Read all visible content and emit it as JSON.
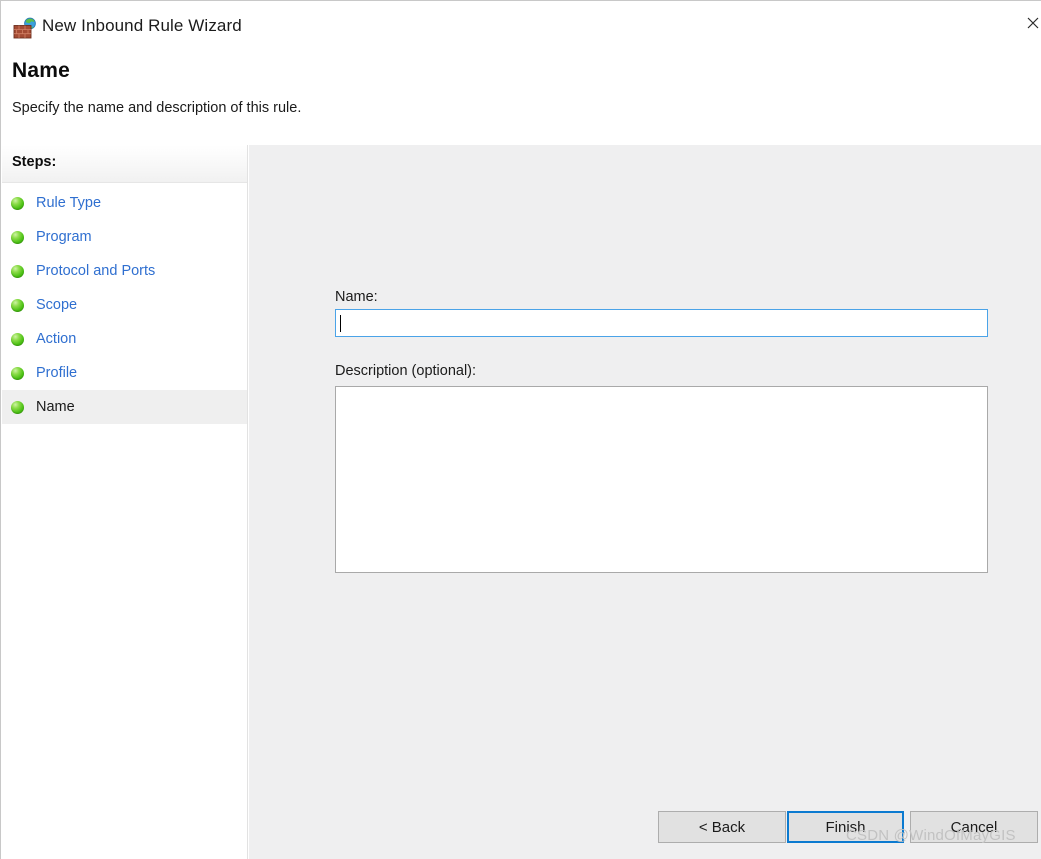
{
  "window": {
    "title": "New Inbound Rule Wizard",
    "icon": "firewall-brick-wall-globe-icon",
    "close_label": "✕"
  },
  "header": {
    "title": "Name",
    "subtitle": "Specify the name and description of this rule."
  },
  "sidebar": {
    "header_label": "Steps:",
    "items": [
      {
        "label": "Rule Type",
        "selected": false
      },
      {
        "label": "Program",
        "selected": false
      },
      {
        "label": "Protocol and Ports",
        "selected": false
      },
      {
        "label": "Scope",
        "selected": false
      },
      {
        "label": "Action",
        "selected": false
      },
      {
        "label": "Profile",
        "selected": false
      },
      {
        "label": "Name",
        "selected": true
      }
    ]
  },
  "form": {
    "name_label": "Name:",
    "name_value": "",
    "name_placeholder": "",
    "description_label": "Description (optional):",
    "description_value": "",
    "description_placeholder": ""
  },
  "footer": {
    "back_label": "< Back",
    "finish_label": "Finish",
    "cancel_label": "Cancel"
  },
  "watermark": {
    "text": "CSDN @WindOfMayGIS"
  },
  "colors": {
    "accent_blue": "#0b7ad0",
    "focus_blue": "#4aa3e8",
    "link_blue": "#2f6fd0",
    "panel_gray": "#efeff0",
    "bullet_green": "#4cc115"
  }
}
